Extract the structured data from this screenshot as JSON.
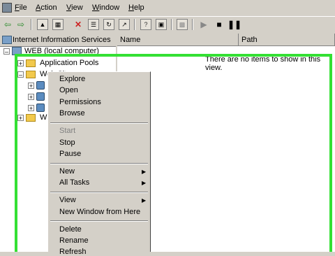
{
  "menubar": {
    "items": [
      {
        "label": "File",
        "ul": "F",
        "rest": "ile"
      },
      {
        "label": "Action",
        "ul": "A",
        "rest": "ction"
      },
      {
        "label": "View",
        "ul": "V",
        "rest": "iew"
      },
      {
        "label": "Window",
        "ul": "W",
        "rest": "indow"
      },
      {
        "label": "Help",
        "ul": "H",
        "rest": "elp"
      }
    ]
  },
  "tree": {
    "header": "Internet Information Services",
    "root": "WEB (local computer)",
    "app_pools": "Application Pools",
    "web_sites": "Web Sites",
    "truncated_w": "W"
  },
  "list": {
    "columns": [
      "Name",
      "Path"
    ],
    "empty_message": "There are no items to show in this view."
  },
  "context_menu": {
    "explore": "Explore",
    "open": "Open",
    "permissions": "Permissions",
    "browse": "Browse",
    "start": "Start",
    "stop": "Stop",
    "pause": "Pause",
    "new": "New",
    "all_tasks": "All Tasks",
    "view": "View",
    "new_window": "New Window from Here",
    "delete": "Delete",
    "rename": "Rename",
    "refresh": "Refresh"
  },
  "colors": {
    "highlight_frame": "#34e034",
    "chrome": "#d4d0c8"
  }
}
